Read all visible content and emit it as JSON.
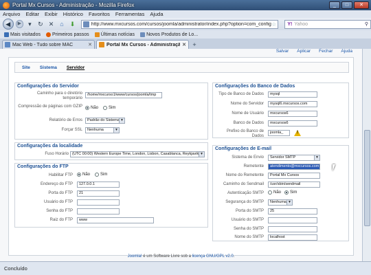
{
  "window": {
    "title": "Portal Mx Cursos - Administração - Mozilla Firefox",
    "min": "_",
    "max": "□",
    "close": "✕"
  },
  "menu": [
    "Arquivo",
    "Editar",
    "Exibir",
    "Histórico",
    "Favoritos",
    "Ferramentas",
    "Ajuda"
  ],
  "nav": {
    "url": "http://www.mxcursos.com/cursos/joomla/administrator/index.php?option=com_config",
    "search_placeholder": "Yahoo",
    "search_engine": "Y!"
  },
  "bookmarks": [
    {
      "label": "Mais visitados",
      "color": "#3a6fb5"
    },
    {
      "label": "Primeiros passos",
      "color": "#e25b00"
    },
    {
      "label": "Últimas notícias",
      "color": "#e58e1a"
    },
    {
      "label": "Novos Produtos de Lo...",
      "color": "#6d8dbb"
    }
  ],
  "tabs": [
    {
      "label": "Mac Web - Tudo sobre MAC",
      "active": false,
      "color": "#5c88c4"
    },
    {
      "label": "Portal Mx Cursos - Administração",
      "active": true,
      "color": "#e58e1a"
    }
  ],
  "toolbar": [
    "Salvar",
    "Aplicar",
    "Fechar",
    "Ajuda"
  ],
  "subnav": [
    "Site",
    "Sistema",
    "Servidor"
  ],
  "servidor": {
    "legend": "Configurações do Servidor",
    "temp_label": "Caminho para o diretório temporário",
    "temp_value": "/home/mxcurso1/www/cursos/joomla/tmp",
    "gzip_label": "Compressão de páginas com GZIP",
    "gzip_no": "Não",
    "gzip_yes": "Sim",
    "erros_label": "Relatório de Erros",
    "erros_value": "Padrão do Sistema",
    "ssl_label": "Forçar SSL",
    "ssl_value": "Nenhuma"
  },
  "localidade": {
    "legend": "Configurações da localidade",
    "fuso_label": "Fuso Horário",
    "fuso_value": "(UTC 00:00) Western Europe Time, London, Lisbon, Casablanca, Reykjavik"
  },
  "ftp": {
    "legend": "Configurações do FTP",
    "habilitar_label": "Habilitar FTP",
    "habilitar_no": "Não",
    "habilitar_yes": "Sim",
    "host_label": "Endereço do FTP",
    "host_value": "127.0.0.1",
    "port_label": "Porta do FTP",
    "port_value": "21",
    "user_label": "Usuário do FTP",
    "user_value": "",
    "pass_label": "Senha do FTP",
    "pass_value": "",
    "root_label": "Raiz do FTP",
    "root_value": "www"
  },
  "banco": {
    "legend": "Configurações do Banco de Dados",
    "tipo_label": "Tipo de Banco de Dados",
    "tipo_value": "mysql",
    "servidor_label": "Nome do Servidor",
    "servidor_value": "mysql6.mxcursos.com",
    "usuario_label": "Nome de Usuário",
    "usuario_value": "mxcursos6",
    "bd_label": "Banco de Dados",
    "bd_value": "mxcursos6",
    "prefixo_label": "Prefixo do Banco de Dados",
    "prefixo_value": "joomla_"
  },
  "email": {
    "legend": "Configurações de E-mail",
    "envio_label": "Sistema de Envio",
    "envio_value": "Servidor SMTP",
    "remetente_label": "Remetente",
    "remetente_value": "atendimento@mxcursos.com",
    "nome_remetente_label": "Nome do Remetente",
    "nome_remetente_value": "Portal Mx Cursos",
    "sendmail_label": "Caminho do Sendmail",
    "sendmail_value": "/usr/sbin/sendmail",
    "auth_label": "Autenticação SMTP",
    "auth_no": "Não",
    "auth_yes": "Sim",
    "seguranca_label": "Segurança do SMTP",
    "seguranca_value": "Nenhuma",
    "porta_label": "Porta do SMTP",
    "porta_value": "25",
    "usuario_label": "Usuário do SMTP",
    "usuario_value": "",
    "senha_label": "Senha do SMTP",
    "senha_value": "",
    "nome_label": "Nome do SMTP",
    "nome_value": "localhost"
  },
  "footer": {
    "link1": "Joomla!",
    "text1": " é um Software Livre sob a ",
    "link2": "licença GNU/GPL v2.0",
    "text2": "."
  },
  "status": "Concluído"
}
